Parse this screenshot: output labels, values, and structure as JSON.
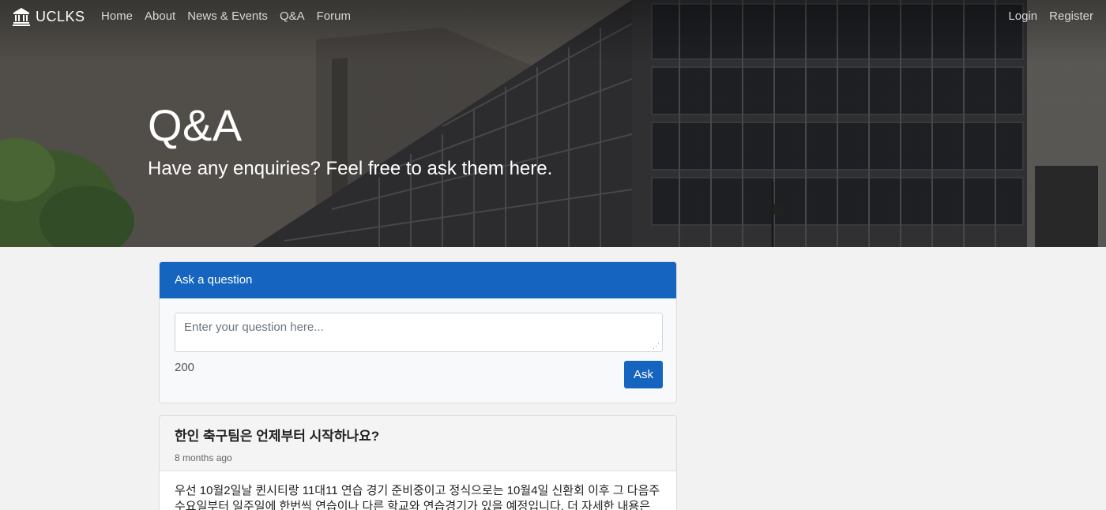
{
  "nav": {
    "brand": "UCLKS",
    "links": [
      "Home",
      "About",
      "News & Events",
      "Q&A",
      "Forum"
    ],
    "login": "Login",
    "register": "Register"
  },
  "hero": {
    "title": "Q&A",
    "subtitle": "Have any enquiries? Feel free to ask them here."
  },
  "ask": {
    "header": "Ask a question",
    "placeholder": "Enter your question here...",
    "char_count": "200",
    "button": "Ask"
  },
  "questions": [
    {
      "title": "한인 축구팀은 언제부터 시작하나요?",
      "time": "8 months ago",
      "answer": "우선 10월2일날 퀸시티랑 11대11 연습 경기 준비중이고 정식으로는 10월4일 신환회 이후 그 다음주 수요일부터 일주일에 한번씩 연습이나 다른 학교와 연습경기가 있을 예정입니다. 더 자세한 내용은 축"
    }
  ],
  "icons": {
    "brand_icon": "building-columns-icon"
  },
  "colors": {
    "primary": "#1565c0",
    "page_background": "#f2f2f2"
  }
}
